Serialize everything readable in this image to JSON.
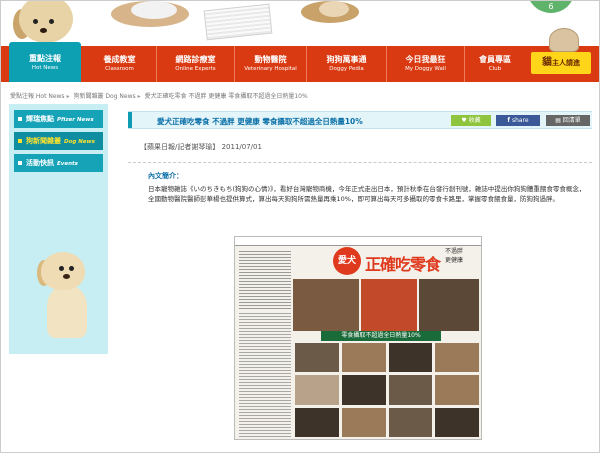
{
  "banner": {
    "badge": "6"
  },
  "nav": {
    "items": [
      {
        "zh": "重點注報",
        "en": "Hot News"
      },
      {
        "zh": "養成教室",
        "en": "Classroom"
      },
      {
        "zh": "網路診療室",
        "en": "Online Experts"
      },
      {
        "zh": "動物醫院",
        "en": "Veterinary Hospital"
      },
      {
        "zh": "狗狗萬事通",
        "en": "Doggy Pedia"
      },
      {
        "zh": "今日我最狂",
        "en": "My Doggy Wall"
      },
      {
        "zh": "會員專區",
        "en": "Club"
      }
    ],
    "cat_button": {
      "big": "貓",
      "label": "主人請進"
    }
  },
  "breadcrumb": {
    "items": [
      "愛點注報 Hot News",
      "狗新聞雜叢 Dog News",
      "愛犬正確吃零食 不過胖 更健康 零食攝取不超過全日熱量10%"
    ]
  },
  "sidebar": {
    "items": [
      {
        "zh": "輝瑞焦點",
        "en": "Pfizer News"
      },
      {
        "zh": "狗新聞雜叢",
        "en": "Dog News"
      },
      {
        "zh": "活動快訊",
        "en": "Events"
      }
    ],
    "active_index": 1
  },
  "article": {
    "title": "愛犬正確吃零食 不過胖 更健康 零食攝取不超過全日熱量10%",
    "buttons": {
      "collect": "收藏",
      "share": "share",
      "back": "回清單"
    },
    "source": "【蘋果日報/記者謝琴瑜】 2011/07/01",
    "intro_label": "內文簡介：",
    "body": "日本寵物雜誌《いのちきもち(狗狗の心情)》，看好台灣寵物商機，今年正式走出日本，預計秋季在台發行創刊號，雜誌中提出你狗狗體重餵食零食概念，全國動物醫院醫師彭華楊也提供算式，算出每天狗狗所需熱量再乘10%，即可算出每天可多攝取的零食卡路里，掌握零食餵食量，防狗狗過胖。"
  },
  "scan": {
    "ai": "愛犬",
    "headline": "正確吃零食",
    "sub1": "不過胖",
    "sub2": "更健康",
    "banner": "零食攝取不超過全日熱量10%"
  }
}
